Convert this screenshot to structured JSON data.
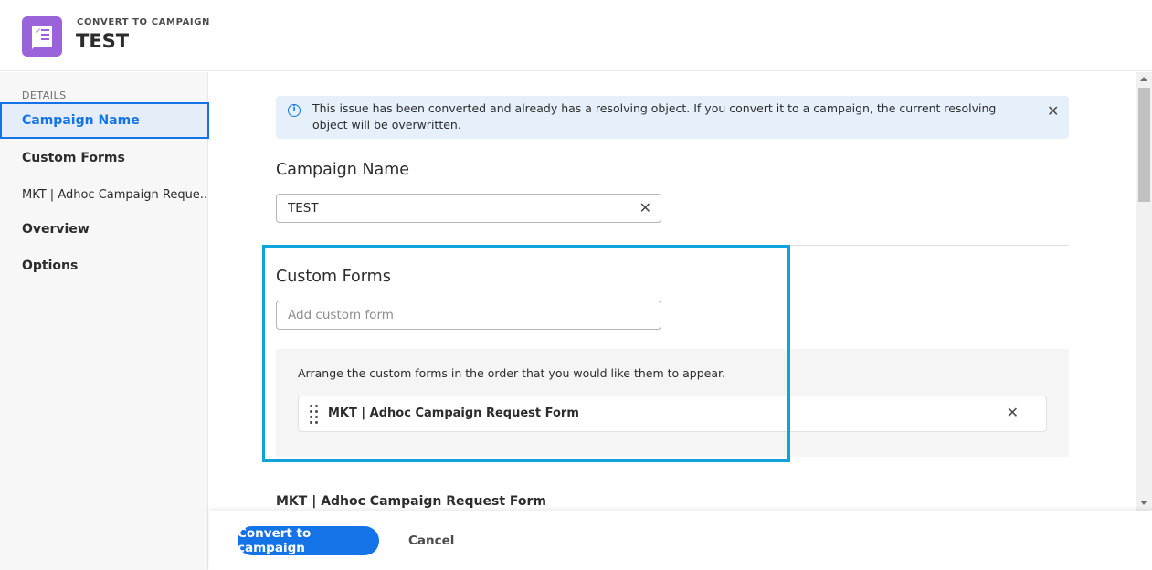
{
  "header": {
    "overline": "CONVERT TO CAMPAIGN",
    "title": "TEST",
    "icon": "checklist-document-icon",
    "icon_color": "#9a63d9"
  },
  "sidebar": {
    "section_label": "DETAILS",
    "items": [
      {
        "label": "Campaign Name",
        "active": true
      },
      {
        "label": "Custom Forms",
        "active": false
      },
      {
        "label": "MKT | Adhoc Campaign Reque...",
        "active": false
      },
      {
        "label": "Overview",
        "active": false
      },
      {
        "label": "Options",
        "active": false
      }
    ]
  },
  "banner": {
    "icon": "info-icon",
    "message": "This issue has been converted and already has a resolving object. If you convert it to a campaign, the current resolving object will be overwritten.",
    "close_icon": "close-icon"
  },
  "campaign_name": {
    "heading": "Campaign Name",
    "value": "TEST"
  },
  "custom_forms": {
    "heading": "Custom Forms",
    "input_placeholder": "Add custom form",
    "arrange_hint": "Arrange the custom forms in the order that you would like them to appear.",
    "forms": [
      {
        "label": "MKT | Adhoc Campaign Request Form"
      }
    ]
  },
  "next_section": {
    "heading": "MKT | Adhoc Campaign Request Form"
  },
  "footer": {
    "primary_label": "Convert to campaign",
    "secondary_label": "Cancel"
  },
  "colors": {
    "accent": "#1473e6",
    "highlight": "#10a3d8",
    "banner_bg": "#e6f0fb"
  }
}
